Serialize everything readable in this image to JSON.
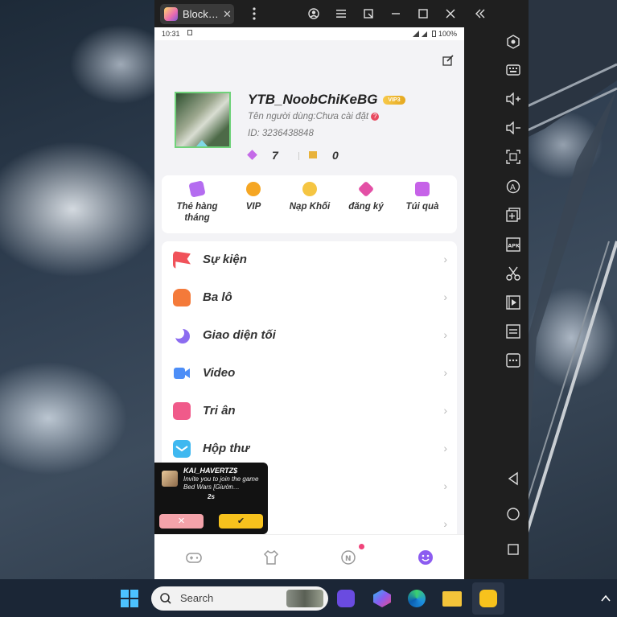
{
  "window": {
    "tab_title": "Block…",
    "tab_close": "✕"
  },
  "status_bar": {
    "time": "10:31",
    "battery": "100%"
  },
  "profile": {
    "username": "YTB_NoobChiKeBG",
    "vip_badge": "VIP3",
    "display_name_line": "Tên người dùng:Chưa cài đặt",
    "id_line": "ID: 3236438848",
    "stat_1": "7",
    "stat_2": "0"
  },
  "quick_actions": [
    {
      "label": "Thẻ hàng tháng",
      "color": "#b46cf0"
    },
    {
      "label": "VIP",
      "color": "#f5a623"
    },
    {
      "label": "Nạp Khối",
      "color": "#f5c542"
    },
    {
      "label": "đăng ký",
      "color": "#e34fa5"
    },
    {
      "label": "Túi quà",
      "color": "#c662e8"
    }
  ],
  "menu": [
    {
      "label": "Sự kiện",
      "icon": "flag-icon",
      "color": "#f0525a"
    },
    {
      "label": "Ba lô",
      "icon": "backpack-icon",
      "color": "#f47a3a"
    },
    {
      "label": "Giao diện tối",
      "icon": "moon-icon",
      "color": "#8c6cf0"
    },
    {
      "label": "Video",
      "icon": "video-icon",
      "color": "#4d8ef7"
    },
    {
      "label": "Tri ân",
      "icon": "thanks-icon",
      "color": "#f05a8a"
    },
    {
      "label": "Hộp thư",
      "icon": "mail-icon",
      "color": "#3fb8f0"
    },
    {
      "label": "",
      "icon": "",
      "color": "#cccccc"
    },
    {
      "label": "",
      "icon": "",
      "color": "#cccccc"
    }
  ],
  "invite_popup": {
    "sender": "KAI_HAVERTZ$",
    "message": "Invite you to join the game Bed Wars [Giườn…",
    "countdown": "2s",
    "decline": "✕",
    "accept": "✔"
  },
  "taskbar": {
    "search_placeholder": "Search"
  }
}
